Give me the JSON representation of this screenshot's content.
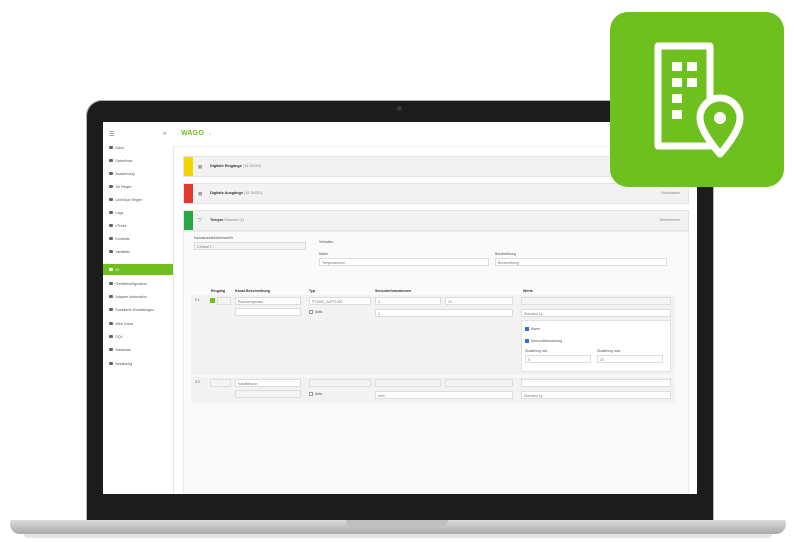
{
  "brand": {
    "logo": "WAGO",
    "accent": "#6ec01e"
  },
  "sidebar": {
    "items": [
      {
        "label": "Dash",
        "icon": "dashboard-icon"
      },
      {
        "label": "Datenfluss",
        "icon": "flow-icon"
      },
      {
        "label": "Auswertung",
        "icon": "chart-icon"
      },
      {
        "label": "Tel Regler",
        "icon": "controller-icon"
      },
      {
        "label": "Linie/Ape Regler",
        "icon": "line-icon"
      },
      {
        "label": "Logs",
        "icon": "logs-icon"
      },
      {
        "label": "I/Trees",
        "icon": "tree-icon"
      },
      {
        "label": "Kontrolle",
        "icon": "control-icon"
      },
      {
        "label": "Variablen",
        "icon": "variables-icon"
      },
      {
        "label": "IO",
        "icon": "io-icon"
      },
      {
        "label": "Gerätekonfiguration",
        "icon": "device-icon"
      },
      {
        "label": "Adapter Information",
        "icon": "adapter-icon"
      },
      {
        "label": "Erweiterte Einstellungen",
        "icon": "settings-icon"
      },
      {
        "label": "Web Cloud",
        "icon": "cloud-icon"
      },
      {
        "label": "SQL",
        "icon": "sql-icon"
      },
      {
        "label": "Hardware",
        "icon": "hardware-icon"
      },
      {
        "label": "Monitoring",
        "icon": "monitor-icon"
      }
    ]
  },
  "panels": [
    {
      "title": "Digitale Eingänge",
      "sub": "(16 DI/DO)",
      "color": "#f5d400",
      "right": ""
    },
    {
      "title": "Digitale Ausgänge",
      "sub": "(16 DI/DO)",
      "color": "#e23a2e",
      "right": "Schnittstelle"
    },
    {
      "title": "Temper",
      "sub": "Element (1)",
      "color": "#2aa744",
      "right": "Übernehmen"
    }
  ],
  "form": {
    "config_label": "Kanalauswahl/Adresse/Nr.",
    "config_value": "2-Kanal T...",
    "settings_label": "Verhalten",
    "name_label": "Name",
    "name_value": "Temperatursen",
    "desc_label": "Beschreibung",
    "desc_value": "Beschreibung"
  },
  "table": {
    "headers": [
      "Eingang",
      "Kanal-Beschreibung",
      "Typ",
      "Sensorinformationen",
      "Werte"
    ],
    "row1": {
      "num": "0.1",
      "desc": "Raumtemperatur",
      "type": "PT1000_2L/PT1000",
      "v1": "0",
      "v2": "10",
      "select": "Standard Lg",
      "chk1": "Aktiv",
      "chk2": "Alarm",
      "chk3": "Sensorüberwachung",
      "f1_label": "Skalierung min",
      "f1": "0",
      "f2_label": "Skalierung max",
      "f2": "20"
    },
    "row2": {
      "num": "0.2",
      "desc": "Kanalbeschr.",
      "chk": "Aktiv",
      "sel": "Kein",
      "select": "Standard Lg"
    }
  }
}
